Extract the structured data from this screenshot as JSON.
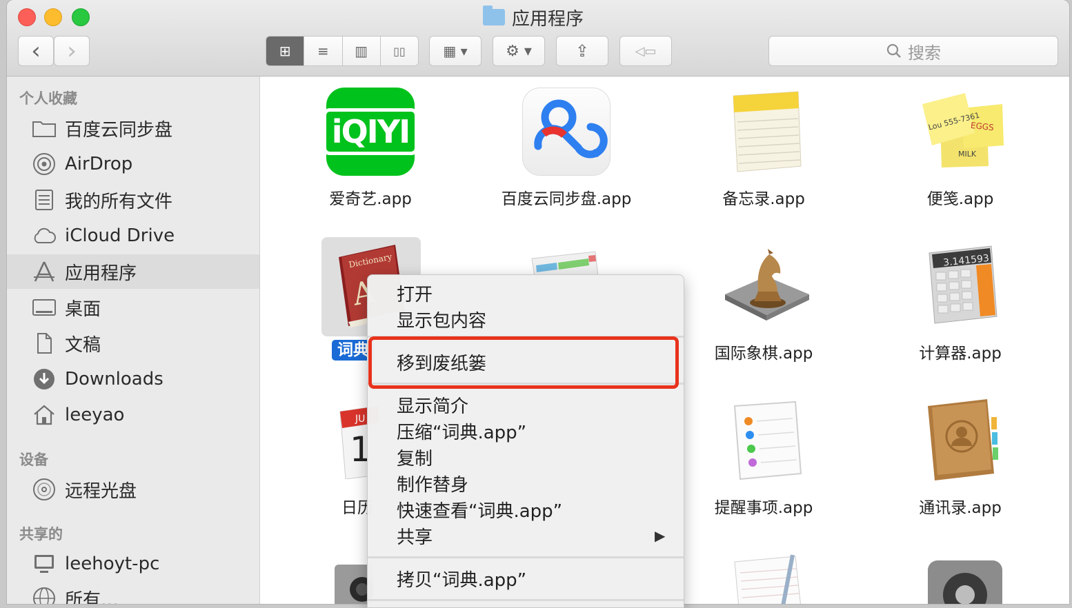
{
  "window": {
    "title": "应用程序"
  },
  "toolbar": {
    "back_label": "‹",
    "forward_label": "›",
    "view_icons_glyph": "⊞",
    "view_list_glyph": "≡",
    "view_columns_glyph": "▥",
    "view_coverflow_glyph": "▯▯",
    "arrange_glyph": "▦ ▾",
    "action_glyph": "⚙ ▾",
    "share_glyph": "⇪",
    "tag_glyph": "◁▭",
    "search_placeholder": "搜索"
  },
  "sidebar": {
    "favorites_heading": "个人收藏",
    "devices_heading": "设备",
    "shared_heading": "共享的",
    "items": [
      {
        "label": "百度云同步盘",
        "icon": "folder-icon",
        "glyph": "▭"
      },
      {
        "label": "AirDrop",
        "icon": "airdrop-icon",
        "glyph": "◎"
      },
      {
        "label": "我的所有文件",
        "icon": "all-files-icon",
        "glyph": "▤"
      },
      {
        "label": "iCloud Drive",
        "icon": "cloud-icon",
        "glyph": "☁"
      },
      {
        "label": "应用程序",
        "icon": "applications-icon",
        "glyph": "A"
      },
      {
        "label": "桌面",
        "icon": "desktop-icon",
        "glyph": "▭"
      },
      {
        "label": "文稿",
        "icon": "documents-icon",
        "glyph": "▯"
      },
      {
        "label": "Downloads",
        "icon": "downloads-icon",
        "glyph": "⬇"
      },
      {
        "label": "leeyao",
        "icon": "home-icon",
        "glyph": "⌂"
      },
      {
        "label": "远程光盘",
        "icon": "disc-icon",
        "glyph": "◉"
      },
      {
        "label": "leehoyt-pc",
        "icon": "computer-icon",
        "glyph": "▭"
      },
      {
        "label": "所有…",
        "icon": "network-icon",
        "glyph": "◍"
      }
    ]
  },
  "apps": [
    {
      "label": "爱奇艺.app",
      "icon": "iqiyi-icon",
      "icon_text": "iQIYI"
    },
    {
      "label": "百度云同步盘.app",
      "icon": "baidu-cloud-icon"
    },
    {
      "label": "备忘录.app",
      "icon": "notes-icon"
    },
    {
      "label": "便笺.app",
      "icon": "stickies-icon",
      "icon_text_1": "Lou 555-7361",
      "icon_text_2": "EGGS",
      "icon_text_3": "MILK"
    },
    {
      "label": "词典.app",
      "label_visible": "词典",
      "icon": "dictionary-icon",
      "icon_text": "Dictionary"
    },
    {
      "label": "国际象棋.app",
      "icon": "chess-icon"
    },
    {
      "label": "计算器.app",
      "icon": "calculator-icon",
      "icon_text": "3.141593"
    },
    {
      "label": "日历",
      "icon": "calendar-icon",
      "icon_text": "JU"
    },
    {
      "label": "提醒事项.app",
      "icon": "reminders-icon"
    },
    {
      "label": "通讯录.app",
      "icon": "contacts-icon"
    }
  ],
  "context_menu": {
    "open": "打开",
    "show_package": "显示包内容",
    "move_to_trash": "移到废纸篓",
    "get_info": "显示简介",
    "compress": "压缩“词典.app”",
    "duplicate": "复制",
    "make_alias": "制作替身",
    "quick_look": "快速查看“词典.app”",
    "share": "共享",
    "share_arrow": "▶",
    "copy": "拷贝“词典.app”"
  },
  "colors": {
    "highlight_box": "#e8321c",
    "selection_blue": "#1a6bd6",
    "iqiyi_green": "#00c21c"
  }
}
